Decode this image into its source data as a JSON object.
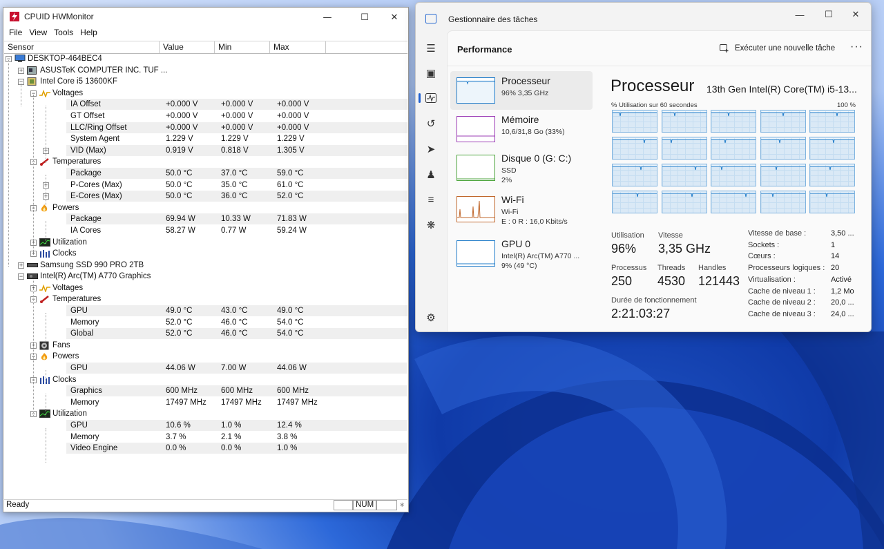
{
  "hwmonitor": {
    "title": "CPUID HWMonitor",
    "menu": [
      "File",
      "View",
      "Tools",
      "Help"
    ],
    "columns": [
      "Sensor",
      "Value",
      "Min",
      "Max"
    ],
    "status": {
      "ready": "Ready",
      "num": "NUM"
    },
    "rows": [
      {
        "label": "DESKTOP-464BEC4",
        "level": 0,
        "icon": "computer-icon",
        "expander": "-"
      },
      {
        "label": "ASUSTeK COMPUTER INC. TUF ...",
        "level": 1,
        "icon": "motherboard-icon",
        "expander": "+"
      },
      {
        "label": "Intel Core i5 13600KF",
        "level": 1,
        "icon": "cpu-chip-icon",
        "expander": "-"
      },
      {
        "label": "Voltages",
        "level": 2,
        "icon": "voltage-icon",
        "expander": "-"
      },
      {
        "label": "IA Offset",
        "level": 3,
        "value": "+0.000 V",
        "min": "+0.000 V",
        "max": "+0.000 V",
        "shaded": true
      },
      {
        "label": "GT Offset",
        "level": 3,
        "value": "+0.000 V",
        "min": "+0.000 V",
        "max": "+0.000 V"
      },
      {
        "label": "LLC/Ring Offset",
        "level": 3,
        "value": "+0.000 V",
        "min": "+0.000 V",
        "max": "+0.000 V",
        "shaded": true
      },
      {
        "label": "System Agent",
        "level": 3,
        "value": "1.229 V",
        "min": "1.229 V",
        "max": "1.229 V"
      },
      {
        "label": "VID (Max)",
        "level": 3,
        "value": "0.919 V",
        "min": "0.818 V",
        "max": "1.305 V",
        "shaded": true,
        "expander": "+"
      },
      {
        "label": "Temperatures",
        "level": 2,
        "icon": "thermometer-icon",
        "expander": "-"
      },
      {
        "label": "Package",
        "level": 3,
        "value": "50.0 °C",
        "min": "37.0 °C",
        "max": "59.0 °C",
        "shaded": true
      },
      {
        "label": "P-Cores (Max)",
        "level": 3,
        "value": "50.0 °C",
        "min": "35.0 °C",
        "max": "61.0 °C",
        "expander": "+"
      },
      {
        "label": "E-Cores (Max)",
        "level": 3,
        "value": "50.0 °C",
        "min": "36.0 °C",
        "max": "52.0 °C",
        "shaded": true,
        "expander": "+"
      },
      {
        "label": "Powers",
        "level": 2,
        "icon": "flame-icon",
        "expander": "-"
      },
      {
        "label": "Package",
        "level": 3,
        "value": "69.94 W",
        "min": "10.33 W",
        "max": "71.83 W",
        "shaded": true
      },
      {
        "label": "IA Cores",
        "level": 3,
        "value": "58.27 W",
        "min": "0.77 W",
        "max": "59.24 W"
      },
      {
        "label": "Utilization",
        "level": 2,
        "icon": "utilization-icon",
        "expander": "+"
      },
      {
        "label": "Clocks",
        "level": 2,
        "icon": "clocks-icon",
        "expander": "+"
      },
      {
        "label": "Samsung SSD 990 PRO 2TB",
        "level": 1,
        "icon": "ssd-icon",
        "expander": "+"
      },
      {
        "label": "Intel(R) Arc(TM) A770 Graphics",
        "level": 1,
        "icon": "gpu-card-icon",
        "expander": "-"
      },
      {
        "label": "Voltages",
        "level": 2,
        "icon": "voltage-icon",
        "expander": "+"
      },
      {
        "label": "Temperatures",
        "level": 2,
        "icon": "thermometer-icon",
        "expander": "-"
      },
      {
        "label": "GPU",
        "level": 3,
        "value": "49.0 °C",
        "min": "43.0 °C",
        "max": "49.0 °C",
        "shaded": true
      },
      {
        "label": "Memory",
        "level": 3,
        "value": "52.0 °C",
        "min": "46.0 °C",
        "max": "54.0 °C"
      },
      {
        "label": "Global",
        "level": 3,
        "value": "52.0 °C",
        "min": "46.0 °C",
        "max": "54.0 °C",
        "shaded": true
      },
      {
        "label": "Fans",
        "level": 2,
        "icon": "fan-icon",
        "expander": "+"
      },
      {
        "label": "Powers",
        "level": 2,
        "icon": "flame-icon",
        "expander": "-"
      },
      {
        "label": "GPU",
        "level": 3,
        "value": "44.06 W",
        "min": "7.00 W",
        "max": "44.06 W",
        "shaded": true
      },
      {
        "label": "Clocks",
        "level": 2,
        "icon": "clocks-icon",
        "expander": "-"
      },
      {
        "label": "Graphics",
        "level": 3,
        "value": "600 MHz",
        "min": "600 MHz",
        "max": "600 MHz",
        "shaded": true
      },
      {
        "label": "Memory",
        "level": 3,
        "value": "17497 MHz",
        "min": "17497 MHz",
        "max": "17497 MHz"
      },
      {
        "label": "Utilization",
        "level": 2,
        "icon": "utilization-icon",
        "expander": "-"
      },
      {
        "label": "GPU",
        "level": 3,
        "value": "10.6 %",
        "min": "1.0 %",
        "max": "12.4 %",
        "shaded": true
      },
      {
        "label": "Memory",
        "level": 3,
        "value": "3.7 %",
        "min": "2.1 %",
        "max": "3.8 %"
      },
      {
        "label": "Video Engine",
        "level": 3,
        "value": "0.0 %",
        "min": "0.0 %",
        "max": "1.0 %",
        "shaded": true
      }
    ]
  },
  "taskmgr": {
    "title": "Gestionnaire des tâches",
    "section": "Performance",
    "new_task": "Exécuter une nouvelle tâche",
    "more": "···",
    "side": [
      {
        "name": "Processeur",
        "d1": "96% 3,35 GHz",
        "d2": "",
        "color": "#1f7bc9"
      },
      {
        "name": "Mémoire",
        "d1": "10,6/31,8 Go (33%)",
        "d2": "",
        "color": "#9b3bb5"
      },
      {
        "name": "Disque 0 (G: C:)",
        "d1": "SSD",
        "d2": "2%",
        "color": "#4aa33a"
      },
      {
        "name": "Wi-Fi",
        "d1": "Wi-Fi",
        "d2": "E : 0 R : 16,0 Kbits/s",
        "color": "#c0672c"
      },
      {
        "name": "GPU 0",
        "d1": "Intel(R) Arc(TM) A770 ...",
        "d2": "9% (49 °C)",
        "color": "#1f7bc9"
      }
    ],
    "main": {
      "title": "Processeur",
      "model": "13th Gen Intel(R) Core(TM) i5-13...",
      "util_label": "% Utilisation sur 60 secondes",
      "util_max": "100 %",
      "stats": {
        "utilisation_label": "Utilisation",
        "utilisation": "96%",
        "vitesse_label": "Vitesse",
        "vitesse": "3,35 GHz",
        "processus_label": "Processus",
        "processus": "250",
        "threads_label": "Threads",
        "threads": "4530",
        "handles_label": "Handles",
        "handles": "121443",
        "uptime_label": "Durée de fonctionnement",
        "uptime": "2:21:03:27"
      },
      "specs": [
        {
          "k": "Vitesse de base :",
          "v": "3,50 ..."
        },
        {
          "k": "Sockets :",
          "v": "1"
        },
        {
          "k": "Cœurs :",
          "v": "14"
        },
        {
          "k": "Processeurs logiques :",
          "v": "20"
        },
        {
          "k": "Virtualisation :",
          "v": "Activé"
        },
        {
          "k": "Cache de niveau 1 :",
          "v": "1,2 Mo"
        },
        {
          "k": "Cache de niveau 2 :",
          "v": "20,0 ..."
        },
        {
          "k": "Cache de niveau 3 :",
          "v": "24,0 ..."
        }
      ]
    }
  }
}
